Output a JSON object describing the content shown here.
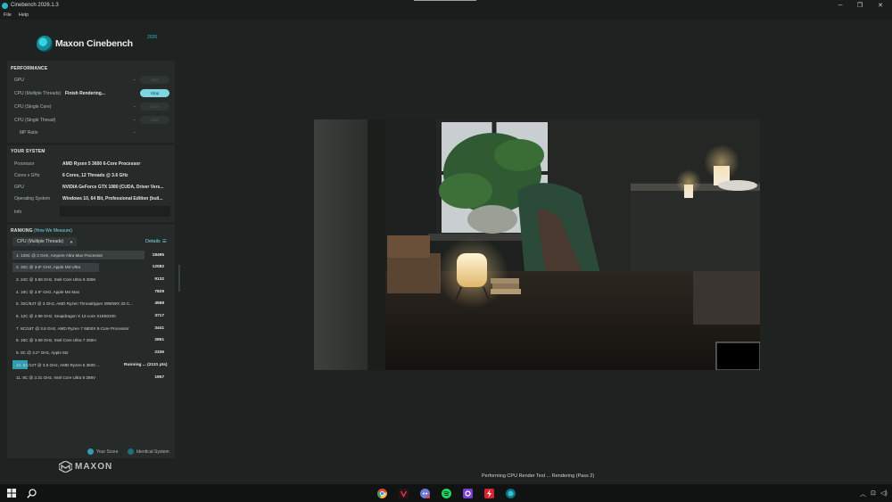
{
  "window": {
    "title": "Cinebench 2026.1.3",
    "controls": [
      "─",
      "❐",
      "✕"
    ]
  },
  "menu": [
    "File",
    "Help"
  ],
  "logo": {
    "name": "Maxon Cinebench",
    "year": "2026"
  },
  "performance": {
    "title": "PERFORMANCE",
    "rows": [
      {
        "label": "GPU",
        "value": "-",
        "button": "Start"
      },
      {
        "label": "CPU (Multiple Threads)",
        "value": "Finish Rendering...",
        "button": "Stop"
      },
      {
        "label": "CPU (Single Core)",
        "value": "-",
        "button": "Start"
      },
      {
        "label": "CPU (Single Thread)",
        "value": "-",
        "button": "Start"
      },
      {
        "label": "MP Ratio",
        "value": "-"
      }
    ]
  },
  "system": {
    "title": "YOUR SYSTEM",
    "rows": [
      {
        "label": "Processor",
        "value": "AMD Ryzen 5 3600 6-Core Processor"
      },
      {
        "label": "Cores x GHz",
        "value": "6 Cores, 12 Threads @ 3.6 GHz"
      },
      {
        "label": "GPU",
        "value": "NVIDIA GeForce GTX 1080 (CUDA, Driver Vers..."
      },
      {
        "label": "Operating System",
        "value": "Windows 10, 64 Bit, Professional Edition (buil..."
      },
      {
        "label": "Info",
        "value": ""
      }
    ]
  },
  "ranking": {
    "title": "RANKING",
    "link": "(How We Measure)",
    "select": "CPU (Multiple Threads)",
    "details": "Details",
    "rows": [
      {
        "label": "1. 128C @ 3 GHz, Ampere Altra Max Processor",
        "score": "18495",
        "fill": 1.0
      },
      {
        "label": "2. 32C @ 3.6* GHz, Apple M3 Ultra",
        "score": "12082",
        "fill": 0.653
      },
      {
        "label": "3. 24C @ 3.69 GHz, Intel Core Ultra 9 285K",
        "score": "9132",
        "fill": 0
      },
      {
        "label": "4. 16C @ 3.9* GHz, Apple M4 Max",
        "score": "7829",
        "fill": 0
      },
      {
        "label": "5. 32C/64T @ 3 GHz, AMD Ryzen Threadripper 2990WX 32-C...",
        "score": "4568",
        "fill": 0
      },
      {
        "label": "6. 12C @ 2.98 GHz, Snapdragon X 12-core X1E80100",
        "score": "3717",
        "fill": 0
      },
      {
        "label": "7. 8C/16T @ 3.8 GHz, AMD Ryzen 7 5800X 8-Core Processor",
        "score": "3441",
        "fill": 0
      },
      {
        "label": "8. 16C @ 3.69 GHz, Intel Core Ultra 7 255H",
        "score": "2861",
        "fill": 0
      },
      {
        "label": "9. 8C @ 3.2* GHz, Apple M2",
        "score": "2336",
        "fill": 0
      },
      {
        "label": "10. 6C/12T @ 3.6 GHz, AMD Ryzen 5 3600 ...",
        "score": "Running ... (2131 pts)",
        "fill": 0.115,
        "current": true
      },
      {
        "label": "11. 8C @ 3.31 GHz, Intel Core Ultra 9 288V",
        "score": "1957",
        "fill": 0
      }
    ],
    "legend": {
      "your_score": "Your Score",
      "identical": "Identical System",
      "your_color": "#2f9fb0",
      "identical_color": "#1f6f7b"
    }
  },
  "brand": "MAXON",
  "status": "Performing CPU Render Test ... Rendering (Pass 2)",
  "taskbar": {
    "apps": [
      "chrome-icon",
      "vivaldi-icon",
      "discord-icon",
      "spotify-icon",
      "app-icon",
      "flash-icon",
      "cinebench-icon"
    ]
  }
}
